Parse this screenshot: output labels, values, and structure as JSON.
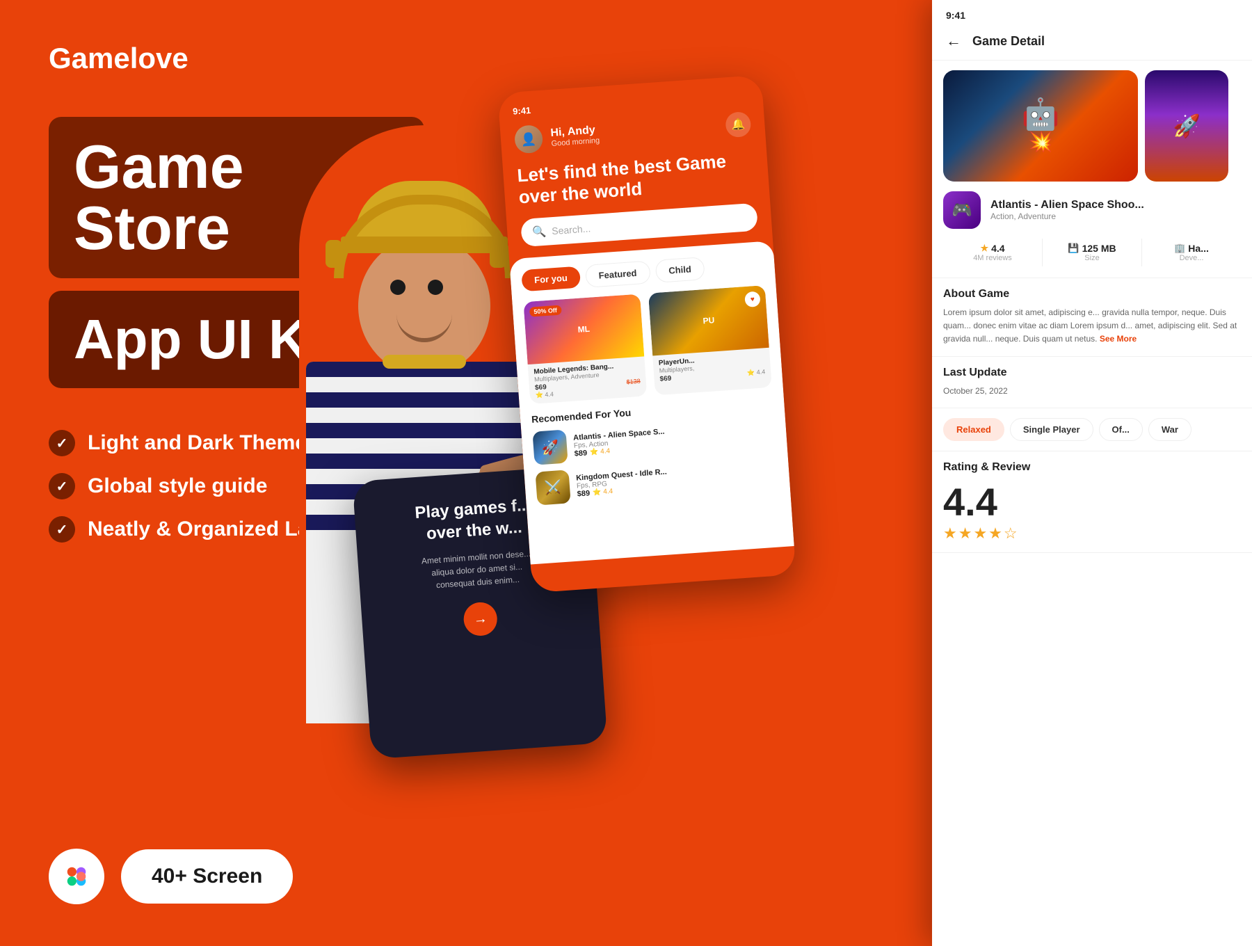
{
  "brand": {
    "name": "Gamelove"
  },
  "hero": {
    "title_line1": "Game Store",
    "title_line2": "App UI Kits"
  },
  "features": [
    "Light and Dark Theme",
    "Global style guide",
    "Neatly & Organized Layer"
  ],
  "bottom": {
    "screen_count": "40+ Screen"
  },
  "phone_main": {
    "status_bar": "9:41",
    "greeting_name": "Hi, Andy",
    "greeting_sub": "Good morning",
    "hero_text": "Let's find the best Game over the world",
    "search_placeholder": "Search...",
    "tabs": [
      "For you",
      "Featured",
      "Child"
    ],
    "game1_name": "Mobile Legends: Bang...",
    "game1_genre": "Multiplayers, Adventure",
    "game1_price": "$69",
    "game1_price_old": "$138",
    "game1_rating": "4.4",
    "game1_badge": "50% Off",
    "game2_name": "PlayerUn...",
    "game2_genre": "Multiplayers,",
    "game2_price": "$69",
    "game2_rating": "4.4",
    "rec_title": "Recomended For You",
    "rec1_name": "Atlantis - Alien Space S...",
    "rec1_genre": "Fps, Action",
    "rec1_price": "$89",
    "rec1_rating": "4.4",
    "rec2_name": "Kingdom Quest - Idle R...",
    "rec2_genre": "Fps, RPG",
    "rec2_price": "$89",
    "rec2_rating": "4.4"
  },
  "phone_dark": {
    "title": "Play games f... over the w...",
    "subtitle": "Amet minim mollit non dese... aliqua dolor do amet si... consequat duis enim..."
  },
  "phone_detail": {
    "status_bar": "9:41",
    "back_label": "←",
    "title": "Game Detail",
    "app_name": "Atlantis - Alien Space Shoo...",
    "app_genre": "Action, Adventure",
    "rating": "4.4",
    "rating_label": "4M reviews",
    "size": "125 MB",
    "size_label": "Size",
    "developer_label": "Deve...",
    "developer_col": "Ha...",
    "about_title": "About Game",
    "about_text": "Lorem ipsum dolor sit amet, adipiscing e... gravida nulla tempor, neque. Duis quam... donec enim vitae ac diam Lorem ipsum d... amet, adipiscing elit. Sed at gravida null... neque. Duis quam ut netus.",
    "see_more": "See More",
    "last_update_title": "Last Update",
    "last_update_date": "October 25, 2022",
    "tags": [
      "Relaxed",
      "Single Player",
      "Of...",
      "War"
    ],
    "rating_review_title": "Rating & Review",
    "rating_big": "4.4"
  },
  "colors": {
    "primary": "#E8420A",
    "dark_brown": "#7A2000",
    "darker_brown": "#6B1A00",
    "white": "#ffffff",
    "dark_bg": "#1a1a2e"
  }
}
